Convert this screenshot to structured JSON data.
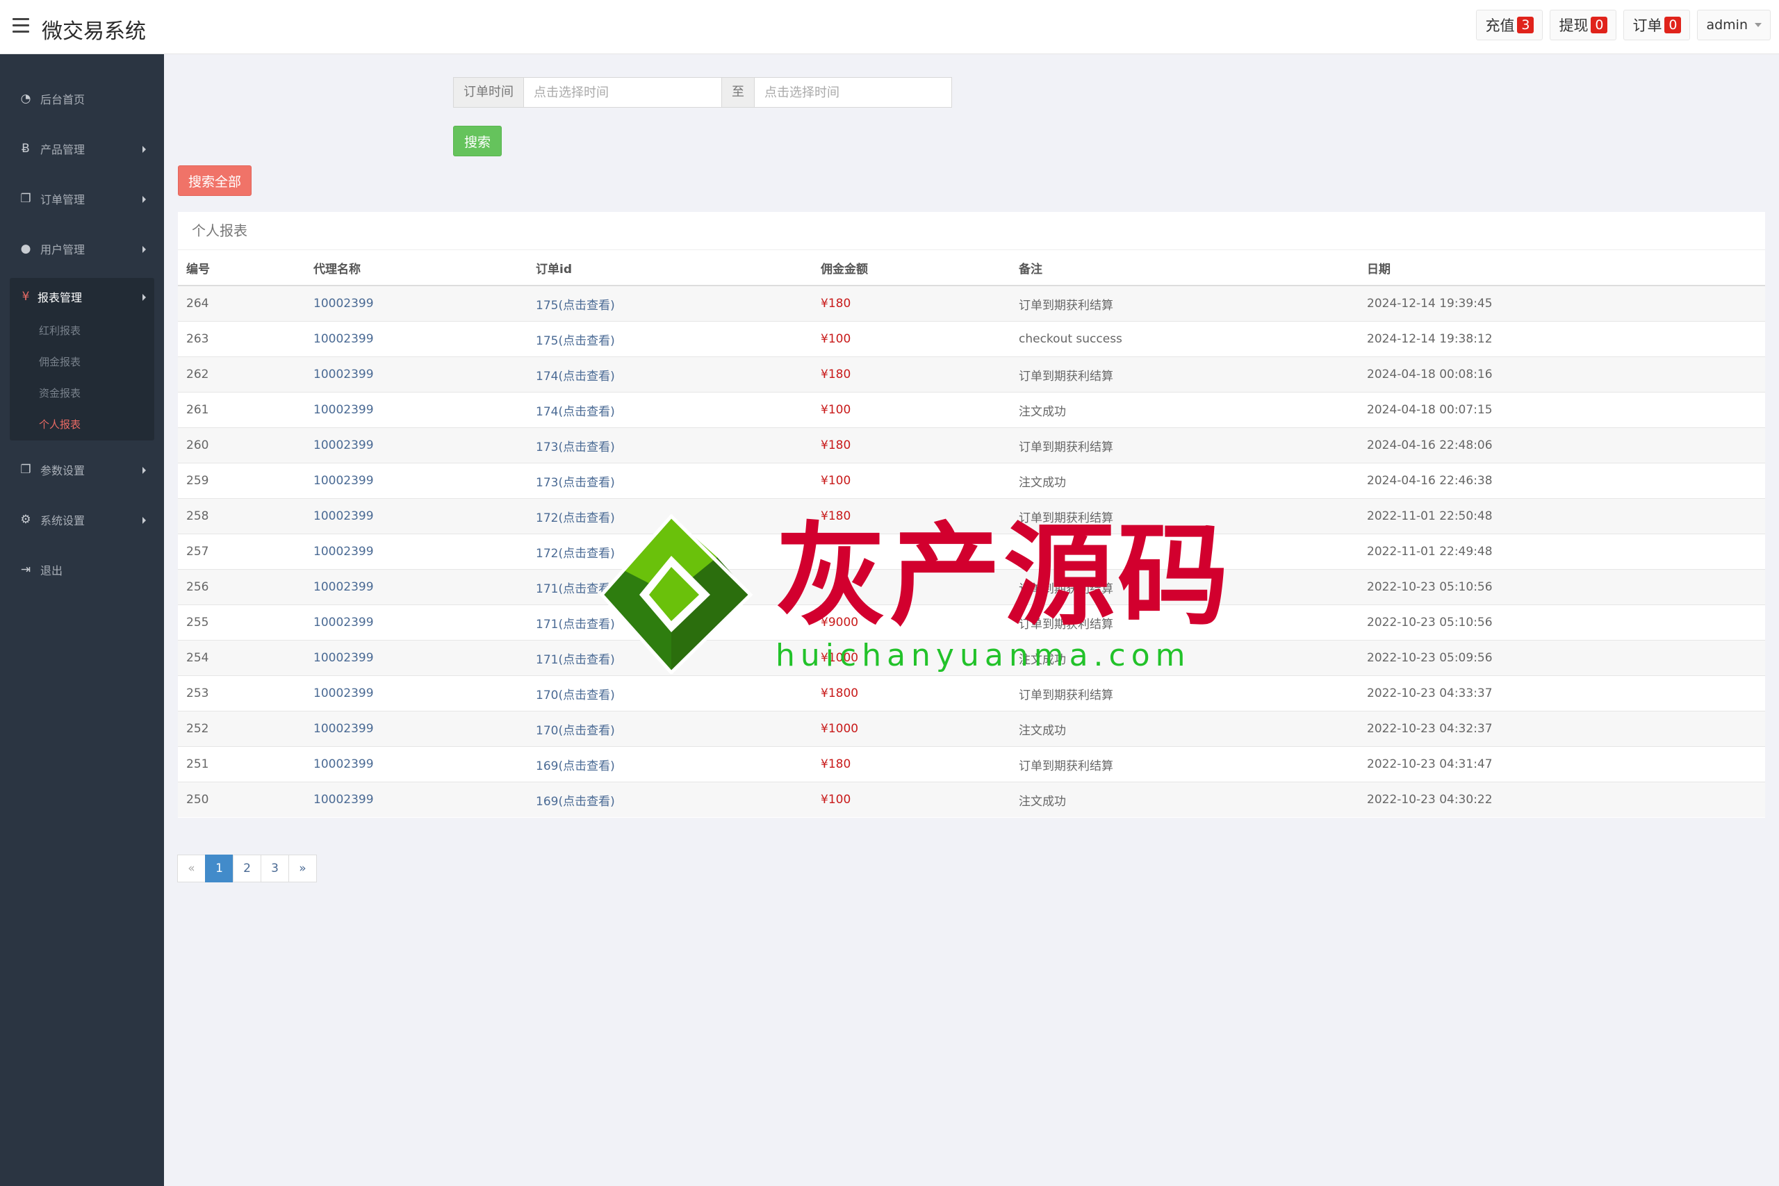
{
  "header": {
    "title": "微交易系统",
    "actions": [
      {
        "label": "充值",
        "badge": "3"
      },
      {
        "label": "提现",
        "badge": "0"
      },
      {
        "label": "订单",
        "badge": "0"
      }
    ],
    "user": "admin"
  },
  "sidebar": {
    "items": [
      {
        "label": "后台首页",
        "icon": "dashboard-icon",
        "glyph": "◔"
      },
      {
        "label": "产品管理",
        "icon": "bitcoin-icon",
        "glyph": "Ƀ"
      },
      {
        "label": "订单管理",
        "icon": "copy-icon",
        "glyph": "❐"
      },
      {
        "label": "用户管理",
        "icon": "user-icon",
        "glyph": "●"
      }
    ],
    "group": {
      "label": "报表管理",
      "icon": "yen-icon",
      "glyph": "¥",
      "subitems": [
        "红利报表",
        "佣金报表",
        "资金报表",
        "个人报表"
      ]
    },
    "items2": [
      {
        "label": "参数设置",
        "icon": "copy-icon",
        "glyph": "❐"
      },
      {
        "label": "系统设置",
        "icon": "gears-icon",
        "glyph": "⚙"
      },
      {
        "label": "退出",
        "icon": "signout-icon",
        "glyph": "⇥"
      }
    ]
  },
  "search": {
    "label": "订单时间",
    "start_placeholder": "点击选择时间",
    "separator": "至",
    "end_placeholder": "点击选择时间",
    "search_button": "搜索",
    "search_all_button": "搜索全部"
  },
  "panel": {
    "title": "个人报表",
    "columns": [
      "编号",
      "代理名称",
      "订单id",
      "佣金金额",
      "备注",
      "日期"
    ],
    "rows": [
      [
        "264",
        "10002399",
        "175(点击查看)",
        "¥180",
        "订单到期获利结算",
        "2024-12-14 19:39:45"
      ],
      [
        "263",
        "10002399",
        "175(点击查看)",
        "¥100",
        "checkout success",
        "2024-12-14 19:38:12"
      ],
      [
        "262",
        "10002399",
        "174(点击查看)",
        "¥180",
        "订单到期获利结算",
        "2024-04-18 00:08:16"
      ],
      [
        "261",
        "10002399",
        "174(点击查看)",
        "¥100",
        "注文成功",
        "2024-04-18 00:07:15"
      ],
      [
        "260",
        "10002399",
        "173(点击查看)",
        "¥180",
        "订单到期获利结算",
        "2024-04-16 22:48:06"
      ],
      [
        "259",
        "10002399",
        "173(点击查看)",
        "¥100",
        "注文成功",
        "2024-04-16 22:46:38"
      ],
      [
        "258",
        "10002399",
        "172(点击查看)",
        "¥180",
        "订单到期获利结算",
        "2022-11-01 22:50:48"
      ],
      [
        "257",
        "10002399",
        "172(点击查看)",
        "",
        "",
        "2022-11-01 22:49:48"
      ],
      [
        "256",
        "10002399",
        "171(点击查看)",
        "",
        "订单到期获利结算",
        "2022-10-23 05:10:56"
      ],
      [
        "255",
        "10002399",
        "171(点击查看)",
        "¥9000",
        "订单到期获利结算",
        "2022-10-23 05:10:56"
      ],
      [
        "254",
        "10002399",
        "171(点击查看)",
        "¥1000",
        "注文成功",
        "2022-10-23 05:09:56"
      ],
      [
        "253",
        "10002399",
        "170(点击查看)",
        "¥1800",
        "订单到期获利结算",
        "2022-10-23 04:33:37"
      ],
      [
        "252",
        "10002399",
        "170(点击查看)",
        "¥1000",
        "注文成功",
        "2022-10-23 04:32:37"
      ],
      [
        "251",
        "10002399",
        "169(点击查看)",
        "¥180",
        "订单到期获利结算",
        "2022-10-23 04:31:47"
      ],
      [
        "250",
        "10002399",
        "169(点击查看)",
        "¥100",
        "注文成功",
        "2022-10-23 04:30:22"
      ]
    ]
  },
  "pagination": {
    "prev": "«",
    "pages": [
      "1",
      "2",
      "3"
    ],
    "current": "1",
    "next": "»"
  },
  "watermark": {
    "text": "灰产源码",
    "url": "huichanyuanma.com"
  },
  "colors": {
    "sidebar_bg": "#2b3542",
    "accent_red": "#f07368",
    "accent_green": "#65c35c",
    "amount_red": "#c81a1a",
    "active_page": "#428bca"
  }
}
